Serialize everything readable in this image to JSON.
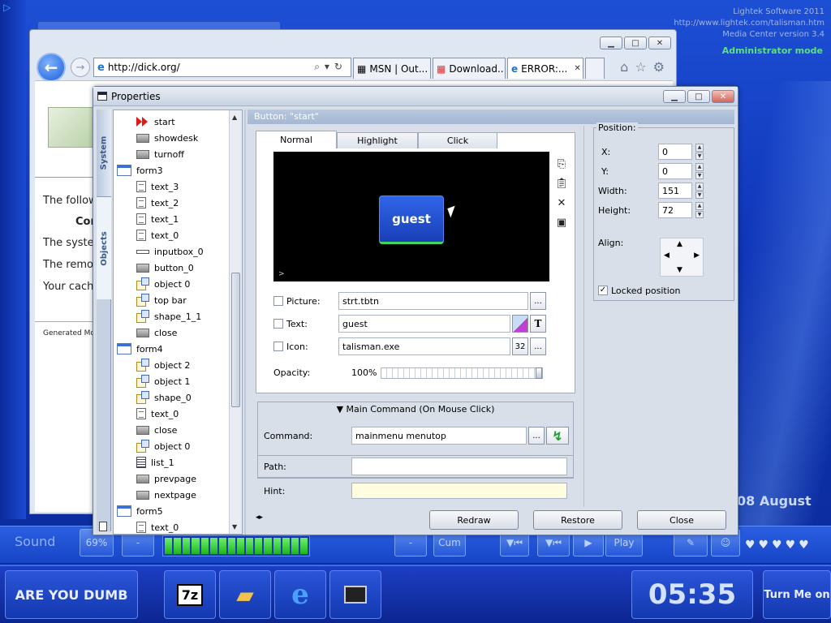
{
  "desktop": {
    "info_lines": [
      "Lightek Software 2011",
      "http://www.lightek.com/talisman.htm",
      "Media Center version 3.4"
    ],
    "mode": "Administrator mode",
    "date": "08 August"
  },
  "media_bar": {
    "sound_label": "Sound",
    "volume": "69%",
    "minus": "-",
    "minus2": "-",
    "cum": "Cum",
    "play": "Play",
    "hearts": "♥♥♥♥♥"
  },
  "taskbar": {
    "left_button": "ARE YOU DUMB",
    "clock": "05:35",
    "right_button": "Turn Me on"
  },
  "browser": {
    "url": "http://dick.org/",
    "tabs": [
      "MSN | Out...",
      "Download...",
      "ERROR:..."
    ],
    "page_lines": [
      "The follow",
      "Cor",
      "The system",
      "The remot",
      "Your cach"
    ],
    "footer": "Generated Mo"
  },
  "props": {
    "title": "Properties",
    "side_tabs": [
      "System",
      "Objects"
    ],
    "tree": [
      {
        "label": "start",
        "icon": "start",
        "indent": 1
      },
      {
        "label": "showdesk",
        "icon": "button",
        "indent": 1
      },
      {
        "label": "turnoff",
        "icon": "button",
        "indent": 1
      },
      {
        "label": "form3",
        "icon": "form",
        "indent": 0
      },
      {
        "label": "text_3",
        "icon": "text",
        "indent": 1
      },
      {
        "label": "text_2",
        "icon": "text",
        "indent": 1
      },
      {
        "label": "text_1",
        "icon": "text",
        "indent": 1
      },
      {
        "label": "text_0",
        "icon": "text",
        "indent": 1
      },
      {
        "label": "inputbox_0",
        "icon": "input",
        "indent": 1
      },
      {
        "label": "button_0",
        "icon": "button",
        "indent": 1
      },
      {
        "label": "object 0",
        "icon": "object",
        "indent": 1
      },
      {
        "label": "top bar",
        "icon": "object",
        "indent": 1
      },
      {
        "label": "shape_1_1",
        "icon": "object",
        "indent": 1
      },
      {
        "label": "close",
        "icon": "button",
        "indent": 1
      },
      {
        "label": "form4",
        "icon": "form",
        "indent": 0
      },
      {
        "label": "object 2",
        "icon": "object",
        "indent": 1
      },
      {
        "label": "object 1",
        "icon": "object",
        "indent": 1
      },
      {
        "label": "shape_0",
        "icon": "object",
        "indent": 1
      },
      {
        "label": "text_0",
        "icon": "text",
        "indent": 1
      },
      {
        "label": "close",
        "icon": "button",
        "indent": 1
      },
      {
        "label": "object 0",
        "icon": "object",
        "indent": 1
      },
      {
        "label": "list_1",
        "icon": "list",
        "indent": 1
      },
      {
        "label": "prevpage",
        "icon": "button",
        "indent": 1
      },
      {
        "label": "nextpage",
        "icon": "button",
        "indent": 1
      },
      {
        "label": "form5",
        "icon": "form",
        "indent": 0
      },
      {
        "label": "text_0",
        "icon": "text",
        "indent": 1
      }
    ],
    "header": "Button: \"start\"",
    "tabs": [
      "Normal",
      "Highlight",
      "Click"
    ],
    "preview_label": "guest",
    "prompt": ">",
    "picture": {
      "label": "Picture:",
      "value": "strt.tbtn",
      "browse": "..."
    },
    "text": {
      "label": "Text:",
      "value": "guest",
      "format": "T"
    },
    "icon": {
      "label": "Icon:",
      "value": "talisman.exe",
      "size": "32",
      "browse": "..."
    },
    "opacity": {
      "label": "Opacity:",
      "value": "100%",
      "level": 1.0
    },
    "main_command": "Main Command (On Mouse Click)",
    "command": {
      "label": "Command:",
      "value": "mainmenu menutop",
      "browse": "..."
    },
    "path": {
      "label": "Path:",
      "value": ""
    },
    "hint": {
      "label": "Hint:",
      "value": ""
    },
    "position": {
      "title": "Position:",
      "x_label": "X:",
      "x": "0",
      "y_label": "Y:",
      "y": "0",
      "width_label": "Width:",
      "width": "151",
      "height_label": "Height:",
      "height": "72",
      "align_label": "Align:",
      "locked_label": "Locked position",
      "locked": true
    },
    "buttons": {
      "redraw": "Redraw",
      "restore": "Restore",
      "close": "Close"
    },
    "nav_arrows": "◂▸"
  },
  "colors": {
    "accent": "#1a3fb8",
    "green": "#3fd85a",
    "text_swatch": "#c040d0"
  }
}
